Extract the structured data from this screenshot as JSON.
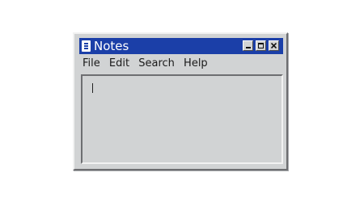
{
  "window": {
    "title": "Notes",
    "icons": {
      "app": "notepad-icon",
      "minimize": "minimize-icon",
      "maximize": "maximize-icon",
      "close": "close-icon"
    }
  },
  "menubar": {
    "items": [
      {
        "label": "File"
      },
      {
        "label": "Edit"
      },
      {
        "label": "Search"
      },
      {
        "label": "Help"
      }
    ]
  },
  "editor": {
    "content": ""
  },
  "colors": {
    "titlebar": "#1b3fa8",
    "window": "#d1d3d4",
    "background": "#ffffff"
  }
}
